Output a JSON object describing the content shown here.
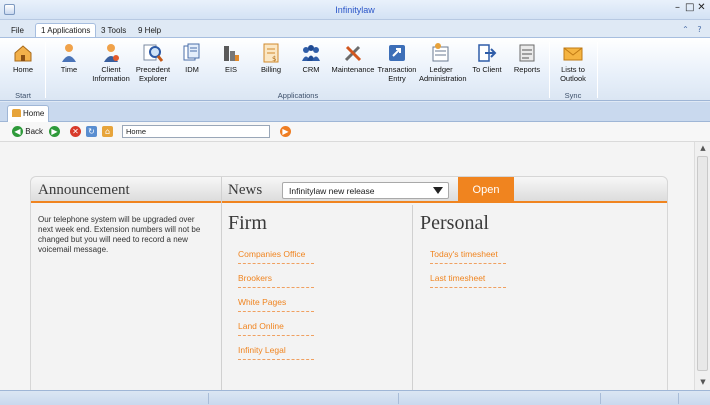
{
  "window": {
    "title": "Infinitylaw"
  },
  "menu": {
    "tabs": [
      {
        "label": "File"
      },
      {
        "label": "1 Applications"
      },
      {
        "label": "3 Tools"
      },
      {
        "label": "9 Help"
      }
    ]
  },
  "ribbon": {
    "buttons": [
      {
        "label": "Home",
        "icon": "home-icon"
      },
      {
        "label": "Time",
        "icon": "person-icon"
      },
      {
        "label": "Client Information",
        "icon": "client-icon"
      },
      {
        "label": "Precedent Explorer",
        "icon": "magnifier-icon"
      },
      {
        "label": "IDM",
        "icon": "documents-icon"
      },
      {
        "label": "EIS",
        "icon": "bar-chart-icon"
      },
      {
        "label": "Billing",
        "icon": "invoice-icon"
      },
      {
        "label": "CRM",
        "icon": "people-icon"
      },
      {
        "label": "Maintenance",
        "icon": "tools-icon"
      },
      {
        "label": "Transaction Entry",
        "icon": "transaction-icon"
      },
      {
        "label": "Ledger Administration",
        "icon": "ledger-icon"
      },
      {
        "label": "To Client",
        "icon": "export-icon"
      },
      {
        "label": "Reports",
        "icon": "report-icon"
      },
      {
        "label": "Lists to Outlook",
        "icon": "envelope-icon"
      }
    ],
    "groups": {
      "start": "Start",
      "applications": "Applications",
      "sync": "Sync"
    }
  },
  "doc_tabs": [
    {
      "label": "Home"
    }
  ],
  "nav": {
    "back_label": "Back",
    "address": "Home"
  },
  "page": {
    "announcement_title": "Announcement",
    "announcement_text": "Our telephone system will be upgraded over next week end. Extension numbers will not be changed but you will need to record a new voicemail message.",
    "news_label": "News",
    "news_selected": "Infinitylaw new release",
    "open_label": "Open",
    "firm": {
      "title": "Firm",
      "links": [
        "Companies Office",
        "Brookers",
        "White Pages",
        "Land Online",
        "Infinity Legal"
      ]
    },
    "personal": {
      "title": "Personal",
      "links": [
        "Today's timesheet",
        "Last timesheet"
      ]
    }
  },
  "colors": {
    "accent": "#f0841f",
    "title_blue": "#2a55c8",
    "ribbon_bg": "#e8f0fa"
  }
}
